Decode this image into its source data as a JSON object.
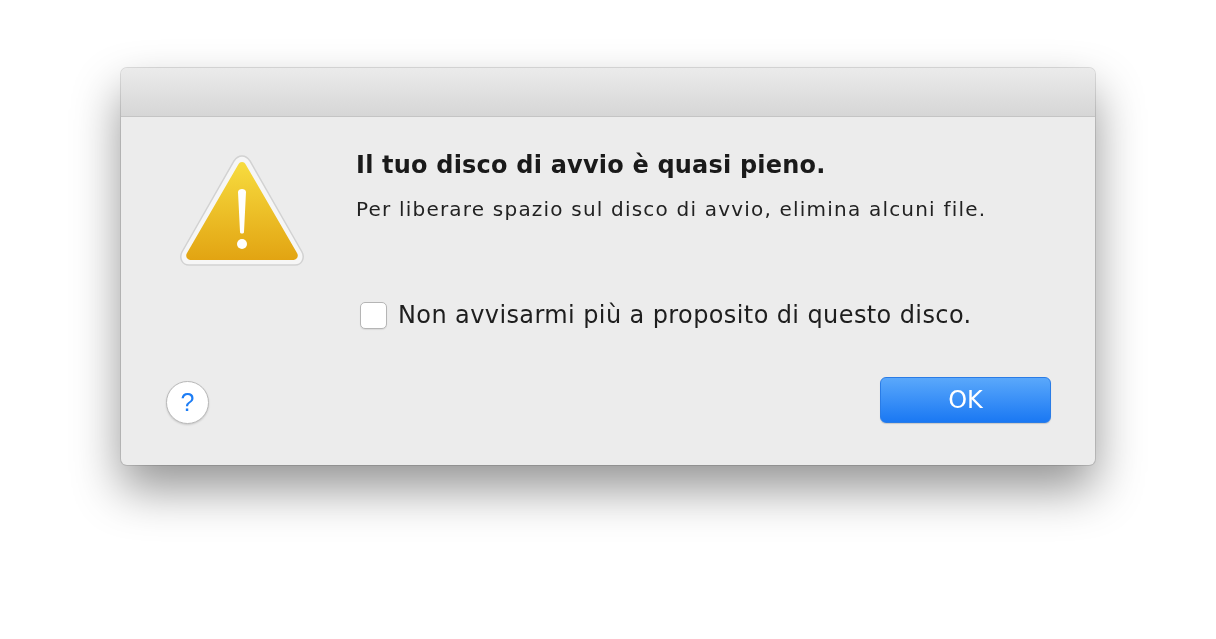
{
  "alert": {
    "title": "Il tuo disco di avvio è quasi pieno.",
    "message": "Per liberare spazio sul disco di avvio, elimina alcuni file.",
    "checkbox": {
      "label": "Non avvisarmi più a proposito di questo disco.",
      "checked": false
    }
  },
  "help_button": {
    "label": "?"
  },
  "buttons": [
    {
      "label": "OK",
      "default": true
    }
  ]
}
